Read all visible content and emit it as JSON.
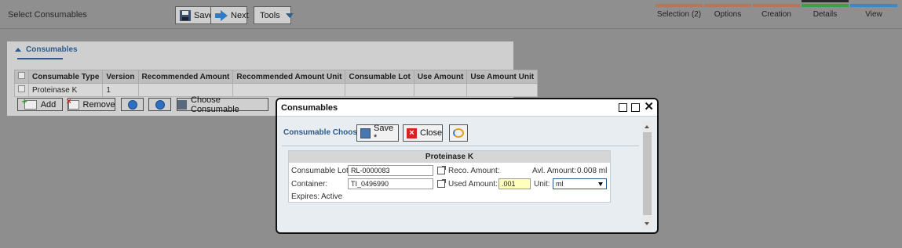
{
  "app": {
    "title": "Select Consumables"
  },
  "toolbar": {
    "save_label": "Save",
    "next_label": "Next",
    "tools_label": "Tools"
  },
  "steps": [
    {
      "label": "Selection (2)",
      "color": "#b07a5a"
    },
    {
      "label": "Options",
      "color": "#b07a5a"
    },
    {
      "label": "Creation",
      "color": "#b07a5a"
    },
    {
      "label": "Details",
      "color": "#3aa14a"
    },
    {
      "label": "View",
      "color": "#3a88c9"
    }
  ],
  "consumables_panel": {
    "title": "Consumables",
    "columns": [
      "Consumable Type",
      "Version",
      "Recommended Amount",
      "Recommended Amount Unit",
      "Consumable Lot",
      "Use Amount",
      "Use Amount Unit"
    ],
    "rows": [
      [
        "Proteinase K",
        "1",
        "",
        "",
        "",
        "",
        ""
      ]
    ],
    "buttons": {
      "add": "Add",
      "remove": "Remove",
      "choose": "Choose Consumable"
    }
  },
  "modal": {
    "title": "Consumables",
    "chooser_label": "Consumable Chooser",
    "save_label": "Save *",
    "close_label": "Close",
    "card": {
      "title": "Proteinase K",
      "lot_label": "Consumable Lot:",
      "lot_value": "RL-0000083",
      "reco_label": "Reco. Amount:",
      "avl_label": "Avl. Amount:",
      "avl_value": "0.008 ml",
      "container_label": "Container:",
      "container_value": "TI_0496990",
      "used_label": "Used Amount:",
      "used_value": ".001",
      "unit_label": "Unit:",
      "unit_value": "ml",
      "expires_label": "Expires:",
      "expires_value": "Active"
    }
  }
}
